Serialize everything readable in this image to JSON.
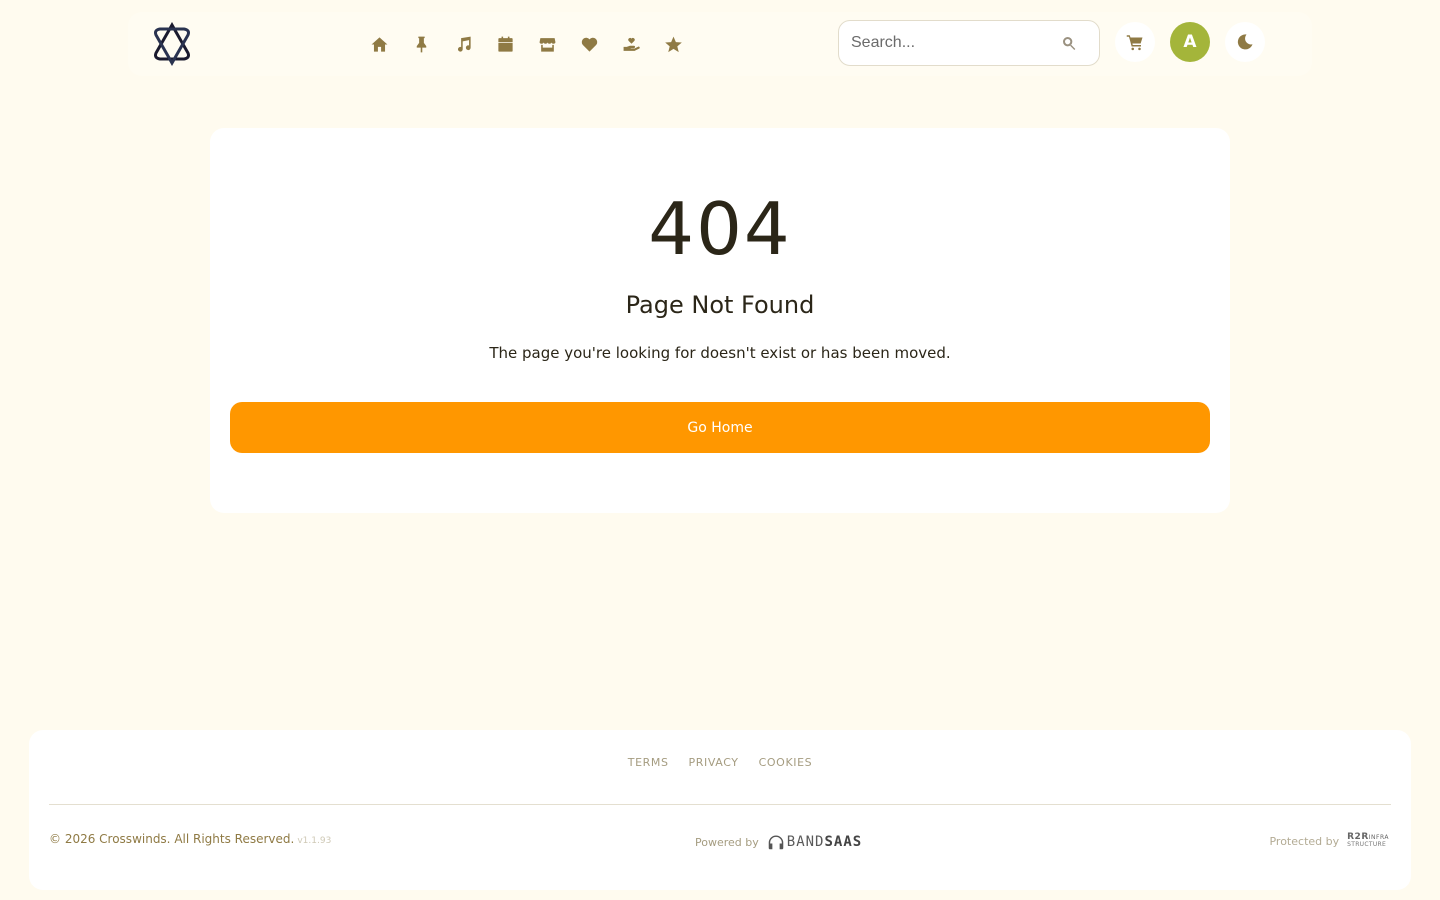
{
  "header": {
    "logo_name": "atom-logo-icon",
    "nav": [
      {
        "name": "home-icon"
      },
      {
        "name": "pin-icon"
      },
      {
        "name": "music-icon"
      },
      {
        "name": "calendar-icon"
      },
      {
        "name": "store-icon"
      },
      {
        "name": "heart-icon"
      },
      {
        "name": "donate-icon"
      },
      {
        "name": "star-icon"
      }
    ],
    "search_placeholder": "Search...",
    "avatar_letter": "A",
    "colors": {
      "accent": "#8f7a44",
      "avatar": "#a4b53a"
    }
  },
  "main": {
    "code": "404",
    "title": "Page Not Found",
    "message": "The page you're looking for doesn't exist or has been moved.",
    "home_button": "Go Home",
    "button_color": "#ff9700"
  },
  "footer": {
    "links": [
      "TERMS",
      "PRIVACY",
      "COOKIES"
    ],
    "copyright": "© 2026 Crosswinds. All Rights Reserved.",
    "version": "v1.1.93",
    "powered_by_label": "Powered by",
    "powered_brand_light": "BAND",
    "powered_brand_bold": "SAAS",
    "protected_label": "Protected by",
    "protected_brand": "R2R",
    "protected_brand_suffix": "INFRA",
    "protected_brand_sub": "STRUCTURE"
  }
}
